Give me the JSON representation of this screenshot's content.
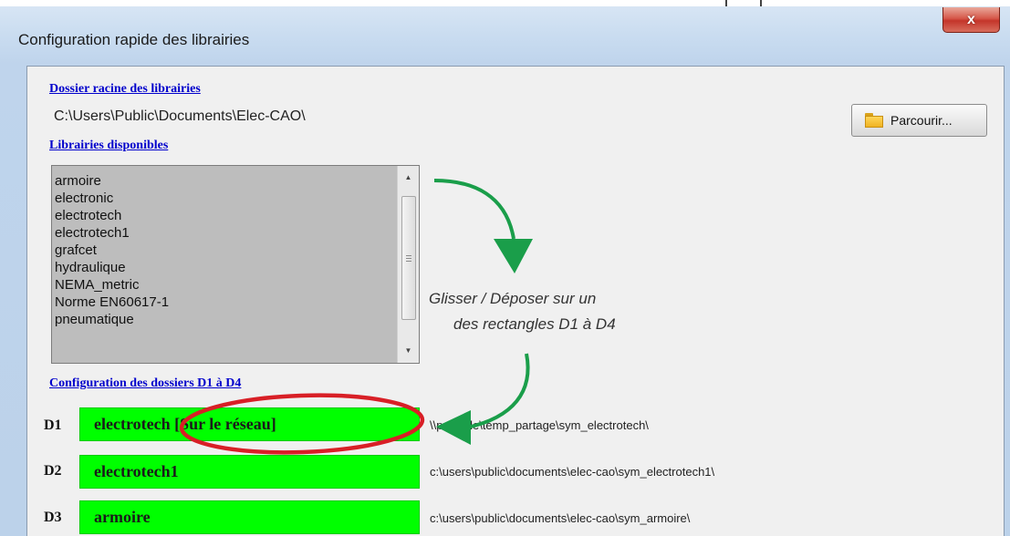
{
  "window": {
    "title": "Configuration rapide des librairies",
    "close_label": "x"
  },
  "root_folder": {
    "heading": "Dossier racine des librairies",
    "path": "C:\\Users\\Public\\Documents\\Elec-CAO\\",
    "browse_label": "Parcourir..."
  },
  "libraries": {
    "heading": "Librairies disponibles",
    "items": [
      "armoire",
      "electronic",
      "electrotech",
      "electrotech1",
      "grafcet",
      "hydraulique",
      "NEMA_metric",
      "Norme EN60617-1",
      "pneumatique"
    ]
  },
  "hint": {
    "line1": "Glisser / Déposer sur un",
    "line2": "des rectangles D1 à D4"
  },
  "folders": {
    "heading": "Configuration des dossiers D1 à D4",
    "rows": [
      {
        "label": "D1",
        "library": "electrotech [Sur le réseau]",
        "path": "\\\\portable\\temp_partage\\sym_electrotech\\"
      },
      {
        "label": "D2",
        "library": "electrotech1",
        "path": "c:\\users\\public\\documents\\elec-cao\\sym_electrotech1\\"
      },
      {
        "label": "D3",
        "library": "armoire",
        "path": "c:\\users\\public\\documents\\elec-cao\\sym_armoire\\"
      }
    ]
  },
  "colors": {
    "drop_zone": "#00ff00",
    "link": "#0000cc",
    "arrow": "#1a9e4a",
    "highlight_circle": "#d81f26"
  }
}
